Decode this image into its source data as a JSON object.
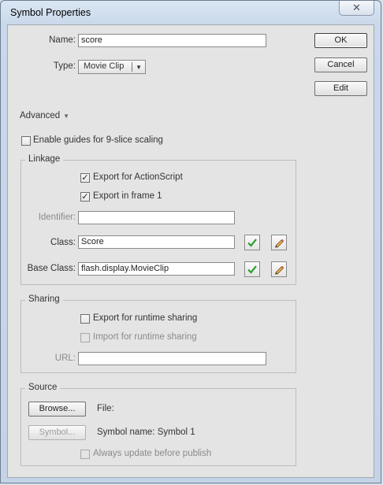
{
  "window": {
    "title": "Symbol Properties",
    "close_glyph": "✕"
  },
  "general": {
    "name_label": "Name:",
    "name_value": "score",
    "type_label": "Type:",
    "type_value": "Movie Clip",
    "dropdown_arrow": "▼"
  },
  "buttons": {
    "ok": "OK",
    "cancel": "Cancel",
    "edit": "Edit"
  },
  "advanced": {
    "label": "Advanced",
    "arrow": "▼",
    "nine_slice_label": "Enable guides for 9-slice scaling",
    "nine_slice_checked": false
  },
  "linkage": {
    "title": "Linkage",
    "export_as_label": "Export for ActionScript",
    "export_as_checked": true,
    "export_frame_label": "Export in frame 1",
    "export_frame_checked": true,
    "identifier_label": "Identifier:",
    "identifier_value": "",
    "class_label": "Class:",
    "class_value": "Score",
    "base_class_label": "Base Class:",
    "base_class_value": "flash.display.MovieClip",
    "validate_icon": "checkmark-icon",
    "edit_icon": "pencil-icon"
  },
  "sharing": {
    "title": "Sharing",
    "export_runtime_label": "Export for runtime sharing",
    "export_runtime_checked": false,
    "import_runtime_label": "Import for runtime sharing",
    "import_runtime_checked": false,
    "url_label": "URL:",
    "url_value": ""
  },
  "source": {
    "title": "Source",
    "browse_label": "Browse...",
    "file_label": "File:",
    "symbol_label": "Symbol...",
    "symbol_name_text": "Symbol name: Symbol 1",
    "always_update_label": "Always update before publish",
    "always_update_checked": false
  },
  "colors": {
    "checkmark": "#2e9e2e",
    "pencil": "#c98a2b"
  },
  "check_glyph": "✓"
}
